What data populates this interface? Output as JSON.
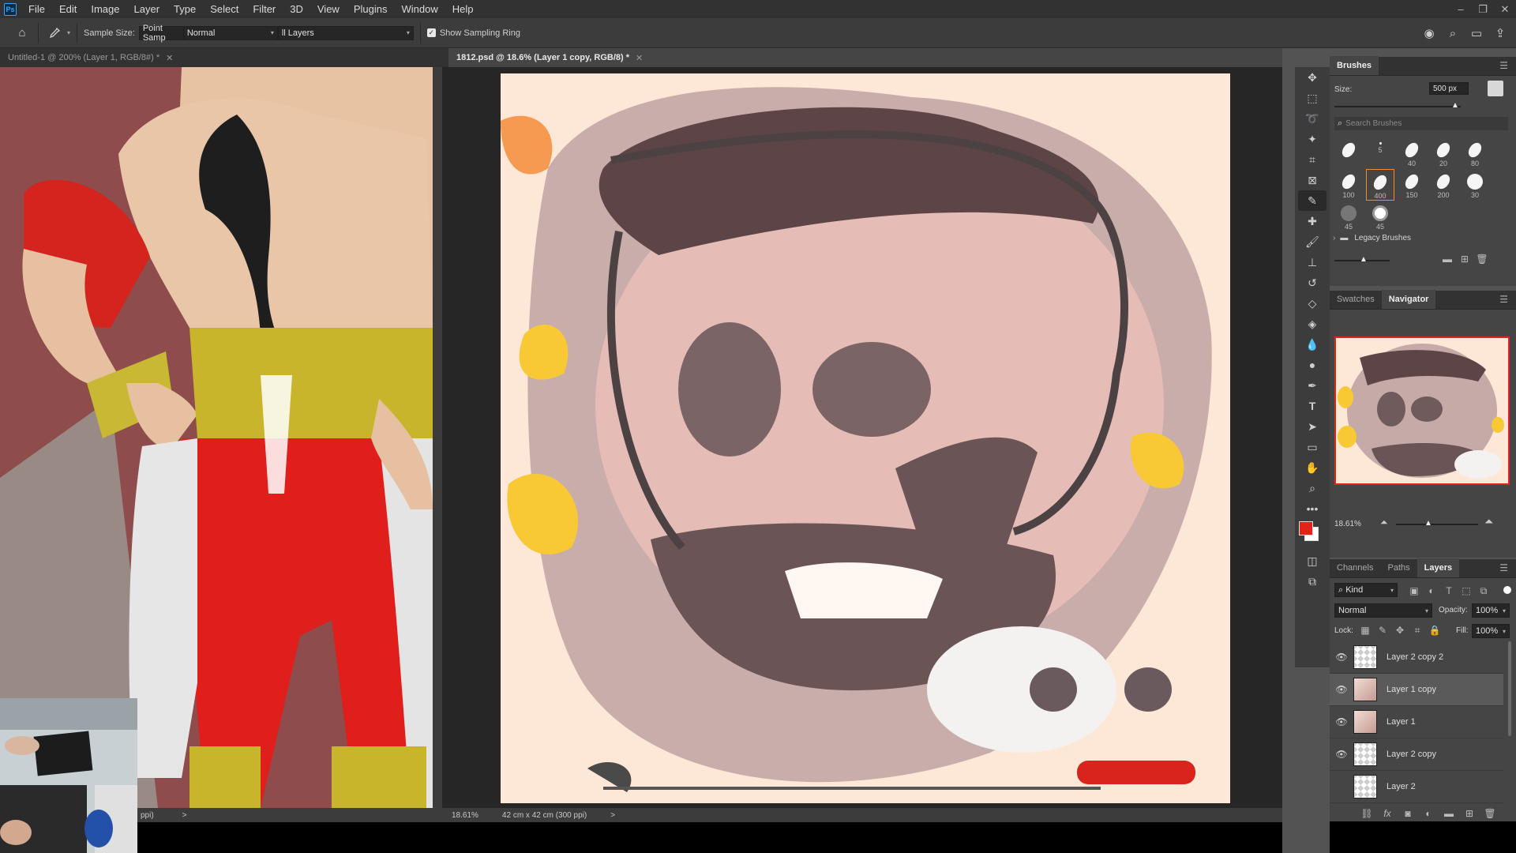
{
  "app": {
    "logo": "Ps"
  },
  "menu": [
    "File",
    "Edit",
    "Image",
    "Layer",
    "Type",
    "Select",
    "Filter",
    "3D",
    "View",
    "Plugins",
    "Window",
    "Help"
  ],
  "window_controls": {
    "minimize": "–",
    "restore": "❐",
    "close": "✕"
  },
  "options": {
    "sample_size_label": "Sample Size:",
    "sample_size_value": "Point Samp",
    "mode_value": "Normal",
    "sample_layers_value": "ll Layers",
    "show_ring_label": "Show Sampling Ring",
    "show_ring_checked": true
  },
  "docs": {
    "left": {
      "tab": "Untitled-1 @ 200% (Layer 1, RGB/8#) *",
      "status_text": "ppi)",
      "status_arrow": ">"
    },
    "main": {
      "tab": "1812.psd @ 18.6% (Layer 1 copy, RGB/8) *",
      "zoom": "18.61%",
      "doc_size": "42 cm x 42 cm (300 ppi)",
      "status_arrow": ">"
    }
  },
  "brushes": {
    "title": "Brushes",
    "size_label": "Size:",
    "size_value": "500 px",
    "search_placeholder": "Search Brushes",
    "presets": [
      {
        "num": ""
      },
      {
        "num": "5"
      },
      {
        "num": "40"
      },
      {
        "num": "20"
      },
      {
        "num": "80"
      },
      {
        "num": "100"
      },
      {
        "num": "400"
      },
      {
        "num": "150"
      },
      {
        "num": "200"
      },
      {
        "num": "30"
      },
      {
        "num": "45"
      },
      {
        "num": "45"
      }
    ],
    "folder": "Legacy Brushes"
  },
  "navigator": {
    "tabs": [
      "Swatches",
      "Navigator"
    ],
    "active": "Navigator",
    "zoom": "18.61%"
  },
  "layers_panel": {
    "tabs": [
      "Channels",
      "Paths",
      "Layers"
    ],
    "active": "Layers",
    "filter_kind": "Kind",
    "blend_mode": "Normal",
    "opacity_label": "Opacity:",
    "opacity_value": "100%",
    "lock_label": "Lock:",
    "fill_label": "Fill:",
    "fill_value": "100%",
    "layers": [
      {
        "name": "Layer 2 copy 2",
        "visible": true,
        "selected": false
      },
      {
        "name": "Layer 1 copy",
        "visible": true,
        "selected": true
      },
      {
        "name": "Layer 1",
        "visible": true,
        "selected": false
      },
      {
        "name": "Layer 2 copy",
        "visible": true,
        "selected": false
      },
      {
        "name": "Layer 2",
        "visible": false,
        "selected": false
      }
    ]
  },
  "colors": {
    "foreground": "#e2231a",
    "background": "#ffffff",
    "canvas_bg": "#fde8d7"
  }
}
